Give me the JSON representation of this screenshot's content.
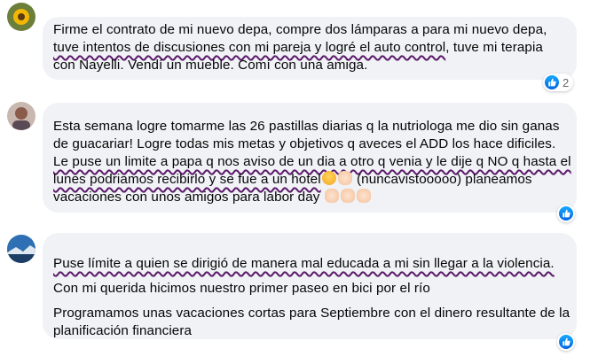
{
  "comments": [
    {
      "lines": [
        {
          "pre": "Firme el contrato de mi nuevo depa, compre dos lámparas a para mi nuevo depa,",
          "ul": "",
          "post": ""
        },
        {
          "pre": "",
          "ul": "tuve intentos de discusiones con mi pareja y logré el auto control",
          "post": ", tuve mi terapia"
        },
        {
          "pre": "con Nayelli. Vendí un mueble. Comí con una amiga.",
          "ul": "",
          "post": ""
        }
      ],
      "reaction": {
        "icon": "like-icon",
        "count": "2"
      }
    },
    {
      "lines": [
        {
          "pre": "Esta semana logre tomarme las 26 pastillas diarias q la nutriologa me dio sin ganas",
          "ul": "",
          "post": ""
        },
        {
          "pre": "de guacariar! Logre todas mis metas y objetivos q aveces el ADD los hace dificiles.",
          "ul": "",
          "post": ""
        },
        {
          "pre": "",
          "ul": "Le puse un limite a papa q nos aviso de un dia a otro q venia y le dije q NO q hasta el",
          "post": ""
        },
        {
          "pre": "",
          "ul": "lunes podriamos recibirlo y se fue a un hotel",
          "post": " (nuncavistooooo) planeamos",
          "emoji_after_ul": true
        },
        {
          "pre": "vacaciones con unos amigos para labor day",
          "ul": "",
          "post": "",
          "emoji_end": true
        }
      ],
      "reaction": {
        "icon": "like-icon",
        "count": ""
      }
    },
    {
      "paragraphs": [
        {
          "ul": "Puse límite a quien se dirigió de manera mal educada a mi sin llegar a la violencia."
        },
        {
          "text": "Con mi querida hicimos nuestro primer paseo en bici por el río"
        },
        {
          "text": "Programamos unas vacaciones cortas para Septiembre con el dinero resultante de la"
        },
        {
          "text": "planificación financiera"
        }
      ],
      "reaction": {
        "icon": "like-icon",
        "count": ""
      }
    }
  ],
  "colors": {
    "bubble": "#f0f2f5",
    "underline": "#5b1a6a",
    "like": "#1877f2"
  }
}
